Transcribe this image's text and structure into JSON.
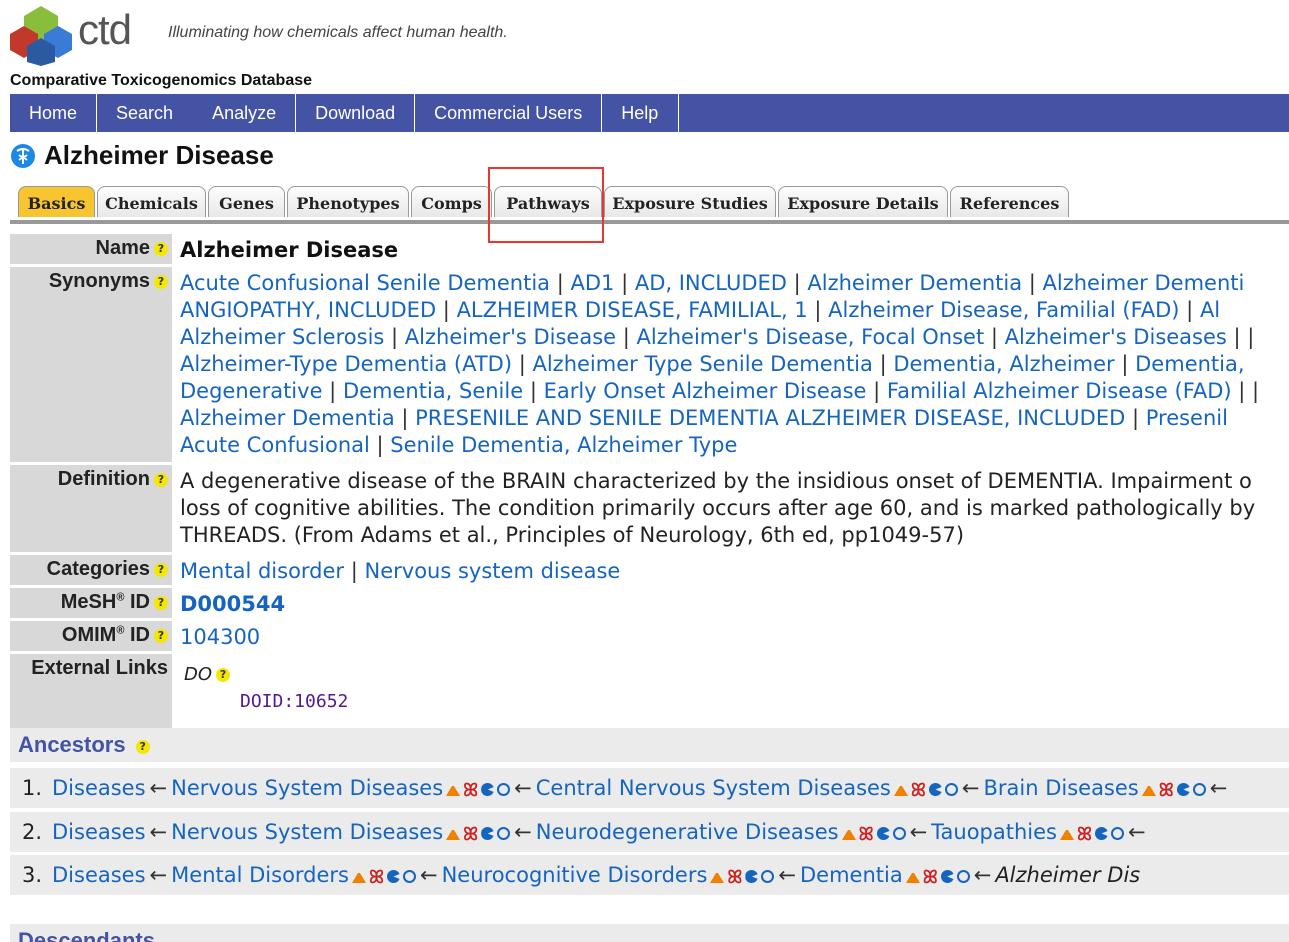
{
  "header": {
    "logo_text": "ctd",
    "tagline": "Illuminating how chemicals affect human health.",
    "db_name": "Comparative Toxicogenomics Database"
  },
  "nav": [
    "Home",
    "Search",
    "Analyze",
    "Download",
    "Commercial Users",
    "Help"
  ],
  "page_title": "Alzheimer Disease",
  "tabs": [
    "Basics",
    "Chemicals",
    "Genes",
    "Phenotypes",
    "Comps",
    "Pathways",
    "Exposure Studies",
    "Exposure Details",
    "References"
  ],
  "active_tab": "Basics",
  "labels": {
    "name": "Name",
    "synonyms": "Synonyms",
    "definition": "Definition",
    "categories": "Categories",
    "mesh": "MeSH",
    "omim": "OMIM",
    "id": "ID",
    "reg": "®",
    "external": "External Links",
    "help": "?"
  },
  "name": "Alzheimer Disease",
  "synonym_lines": [
    [
      "Acute Confusional Senile Dementia",
      "AD1",
      "AD, INCLUDED",
      "Alzheimer Dementia",
      "Alzheimer Dementi"
    ],
    [
      "ANGIOPATHY, INCLUDED",
      "ALZHEIMER DISEASE, FAMILIAL, 1",
      "Alzheimer Disease, Familial (FAD)",
      "Al"
    ],
    [
      "Alzheimer Sclerosis",
      "Alzheimer's Disease",
      "Alzheimer's Disease, Focal Onset",
      "Alzheimer's Diseases",
      ""
    ],
    [
      "Alzheimer-Type Dementia (ATD)",
      "Alzheimer Type Senile Dementia",
      "Dementia, Alzheimer",
      "Dementia,"
    ],
    [
      "Degenerative",
      "Dementia, Senile",
      "Early Onset Alzheimer Disease",
      "Familial Alzheimer Disease (FAD)",
      ""
    ],
    [
      "Alzheimer Dementia",
      "PRESENILE AND SENILE DEMENTIA ALZHEIMER DISEASE, INCLUDED",
      "Presenil"
    ],
    [
      "Acute Confusional",
      "Senile Dementia, Alzheimer Type"
    ]
  ],
  "definition_lines": [
    "A degenerative disease of the BRAIN characterized by the insidious onset of DEMENTIA. Impairment o",
    "loss of cognitive abilities. The condition primarily occurs after age 60, and is marked pathologically by",
    "THREADS. (From Adams et al., Principles of Neurology, 6th ed, pp1049-57)"
  ],
  "categories": [
    "Mental disorder",
    "Nervous system disease"
  ],
  "mesh_id": "D000544",
  "omim_id": "104300",
  "external": {
    "source": "DO",
    "doid": "DOID:10652"
  },
  "ancestors": {
    "title": "Ancestors",
    "rows": [
      {
        "num": "1.",
        "path": [
          "Diseases",
          "Nervous System Diseases",
          "Central Nervous System Diseases",
          "Brain Diseases"
        ],
        "end": ""
      },
      {
        "num": "2.",
        "path": [
          "Diseases",
          "Nervous System Diseases",
          "Neurodegenerative Diseases",
          "Tauopathies"
        ],
        "end": ""
      },
      {
        "num": "3.",
        "path": [
          "Diseases",
          "Mental Disorders",
          "Neurocognitive Disorders",
          "Dementia"
        ],
        "end": "Alzheimer Dis"
      }
    ]
  },
  "descendants_title": "Descendants",
  "glyphs": {
    "arrow": "←",
    "sep": "|",
    "dna": "ꕤ"
  },
  "colors": {
    "nav": "#4453a4",
    "link": "#1565c0",
    "active_tab": "#f7c52f",
    "highlight": "#e33333"
  }
}
